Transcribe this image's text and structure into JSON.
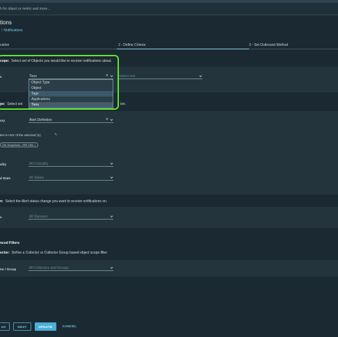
{
  "search": {
    "placeholder": "h for object or metric and more..."
  },
  "page": {
    "title": "tions"
  },
  "breadcrumb": {
    "sep": "/",
    "current": "Notifications"
  },
  "steps": [
    {
      "label": "cation"
    },
    {
      "label": "2 - Define Criteria"
    },
    {
      "label": "3 - Set Outbound Method"
    }
  ],
  "object_scope": {
    "heading": "cope:",
    "description": "Select set of Objects you would like to receive notifications about.",
    "field_label": "s",
    "selected": "Tiers",
    "secondary_placeholder": "Select one",
    "options": [
      "Object Type",
      "Object",
      "Tags",
      "Applications",
      "Tiers"
    ]
  },
  "alert_scope": {
    "heading": "pe:",
    "description_start": "Select set",
    "description_end": "ion.",
    "category_label": "ory",
    "category_value": "Alert Definition",
    "match_label": "lert is ANY of the selected (1):",
    "chip_label": "Old Snapshots, vRB VMs",
    "chip_close": "×",
    "criticality_label": "ality",
    "criticality_value": "All Criticality",
    "state_label": "d State",
    "state_value": "All States"
  },
  "alert_status": {
    "heading": "n:",
    "description": "Select the Alert status change you want to receive notifications on.",
    "field_label": "s",
    "value": "All Statuses"
  },
  "advanced": {
    "heading": "nced Filters",
    "collector_heading": "ector:",
    "collector_description": "Define a Collector or Collector Group based object scope filter.",
    "field_label": "tor / Group",
    "value": "All Collectors and Groups"
  },
  "buttons": {
    "previous": "US",
    "next": "NEXT",
    "update": "UPDATE",
    "cancel": "CANCEL"
  },
  "colors": {
    "background": "#1b2a32",
    "panel": "#23343d",
    "accent": "#49afd9",
    "highlight": "#5fe32b"
  }
}
